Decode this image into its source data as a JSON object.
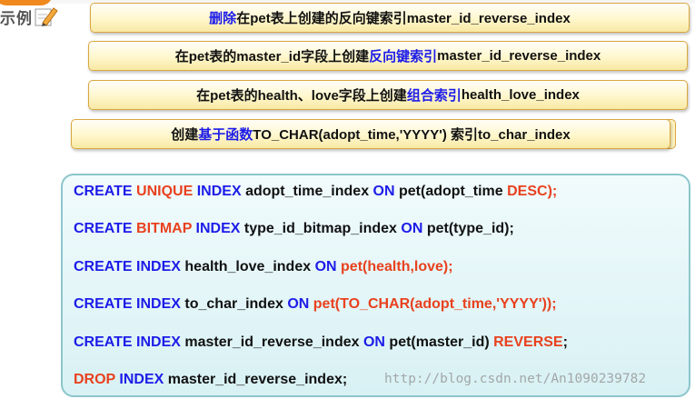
{
  "header": {
    "label": "示例"
  },
  "statements": [
    {
      "parts": [
        "删除",
        "在pet表上创建的反向键索引master_id_reverse_index"
      ]
    },
    {
      "parts": [
        "在pet表的master_id字段上创建",
        "反向键索引",
        "master_id_reverse_index"
      ]
    },
    {
      "parts": [
        "在pet表的health、love字段上创建",
        "组合索引",
        "health_love_index"
      ]
    },
    {
      "parts": [
        "创建",
        "基于函数",
        "TO_CHAR(adopt_time,'YYYY') 索引to_char_index"
      ]
    }
  ],
  "code_lines": [
    [
      "CREATE ",
      "UNIQUE ",
      "INDEX ",
      "adopt_time_index ",
      "ON ",
      "pet(adopt_time ",
      "DESC);"
    ],
    [
      "CREATE ",
      "BITMAP ",
      "INDEX ",
      "type_id_bitmap_index ",
      "ON ",
      "pet(type_id);"
    ],
    [
      "CREATE INDEX ",
      "health_love_index ",
      "ON ",
      "pet(health,love);"
    ],
    [
      "CREATE INDEX ",
      "to_char_index ",
      "ON ",
      "pet(TO_CHAR(adopt_time,'YYYY'));"
    ],
    [
      "CREATE INDEX ",
      "master_id_reverse_index ",
      "ON ",
      "pet(master_id) ",
      "REVERSE",
      ";"
    ],
    [
      "DROP ",
      "INDEX ",
      "master_id_reverse_index;"
    ]
  ],
  "watermark": "http://blog.csdn.net/An1090239782",
  "colors": {
    "keyword": "#1c1ce8",
    "red": "#e8411e",
    "badge": "#f08a1e"
  }
}
